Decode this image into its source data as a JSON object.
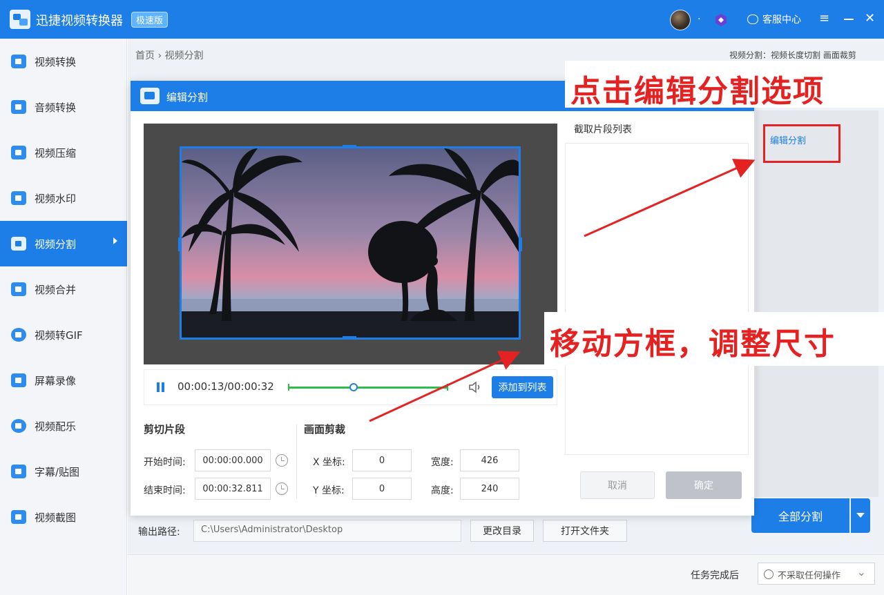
{
  "app": {
    "title": "迅捷视频转换器",
    "badge": "极速版",
    "support_label": "客服中心"
  },
  "titlebar_icons": {
    "menu": "≡",
    "close": "✕"
  },
  "sidebar": {
    "items": [
      {
        "label": "视频转换",
        "icon": "video-convert-icon"
      },
      {
        "label": "音频转换",
        "icon": "audio-convert-icon"
      },
      {
        "label": "视频压缩",
        "icon": "video-compress-icon"
      },
      {
        "label": "视频水印",
        "icon": "video-watermark-icon"
      },
      {
        "label": "视频分割",
        "icon": "video-split-icon",
        "active": true
      },
      {
        "label": "视频合并",
        "icon": "video-merge-icon"
      },
      {
        "label": "视频转GIF",
        "icon": "video-gif-icon"
      },
      {
        "label": "屏幕录像",
        "icon": "screen-record-icon"
      },
      {
        "label": "视频配乐",
        "icon": "video-music-icon"
      },
      {
        "label": "字幕/贴图",
        "icon": "subtitle-sticker-icon"
      },
      {
        "label": "视频截图",
        "icon": "video-screenshot-icon"
      }
    ]
  },
  "breadcrumb": {
    "home": "首页",
    "separator": "›",
    "current": "视频分割"
  },
  "split_mode_text": "视频分割：视频长度切割 画面裁剪",
  "right_panel": {
    "edit_split_link": "编辑分割"
  },
  "dialog": {
    "title": "编辑分割",
    "timecode": "00:00:13/00:00:32",
    "progress_fraction": 0.41,
    "add_to_list_label": "添加到列表",
    "cut_section_title": "剪切片段",
    "start_label": "开始时间:",
    "start_value": "00:00:00.000",
    "end_label": "结束时间:",
    "end_value": "00:00:32.811",
    "crop_section_title": "画面剪裁",
    "x_label": "X 坐标:",
    "x_value": "0",
    "y_label": "Y 坐标:",
    "y_value": "0",
    "width_label": "宽度:",
    "width_value": "426",
    "height_label": "高度:",
    "height_value": "240",
    "list_title": "截取片段列表",
    "cancel_label": "取消",
    "ok_label": "确定"
  },
  "output": {
    "label": "输出路径:",
    "path": "C:\\Users\\Administrator\\Desktop",
    "change_dir_label": "更改目录",
    "open_folder_label": "打开文件夹"
  },
  "split_all_label": "全部分割",
  "task": {
    "label": "任务完成后",
    "value": "不采取任何操作"
  },
  "annotations": {
    "top": "点击编辑分割选项",
    "middle": "移动方框，调整尺寸"
  },
  "colors": {
    "primary": "#1e7ee8",
    "annotation_red": "#e52222",
    "track_green": "#2ebd4a"
  }
}
